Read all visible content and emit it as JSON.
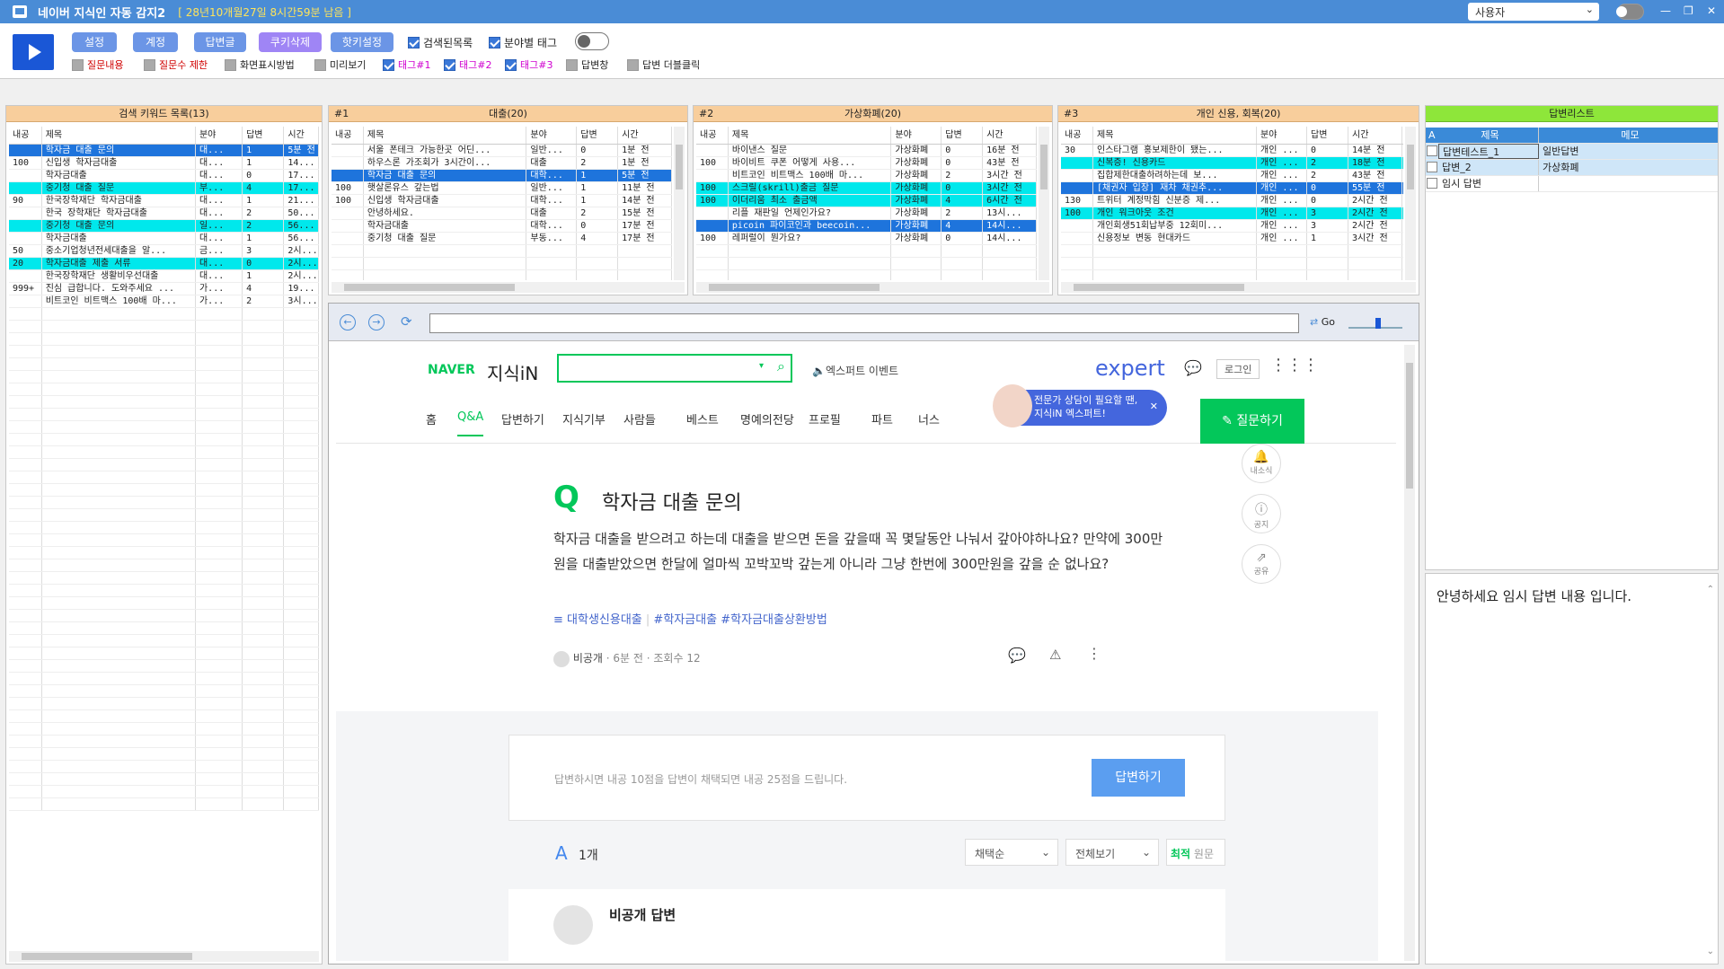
{
  "app": {
    "title": "네이버 지식인 자동 감지2",
    "license": "[ 28년10개월27일 8시간59분 남음 ]",
    "user_select": "사용자",
    "accent": "#4a8cd6"
  },
  "toolbar": {
    "buttons": [
      "설정",
      "계정",
      "답변글",
      "쿠키삭제",
      "핫키설정"
    ],
    "row1_checks": [
      {
        "label": "검색된목록",
        "checked": true
      },
      {
        "label": "분야별 태그",
        "checked": true
      }
    ],
    "row2_checks": [
      {
        "label": "질문내용",
        "checked": false,
        "color": "#d00000"
      },
      {
        "label": "질문수 제한",
        "checked": false,
        "color": "#d00000"
      },
      {
        "label": "화면표시방법",
        "checked": false,
        "color": "#222222"
      },
      {
        "label": "미리보기",
        "checked": false,
        "color": "#222222"
      },
      {
        "label": "태그#1",
        "checked": true,
        "color": "#d000d0"
      },
      {
        "label": "태그#2",
        "checked": true,
        "color": "#d000d0"
      },
      {
        "label": "태그#3",
        "checked": true,
        "color": "#d000d0"
      },
      {
        "label": "답변창",
        "checked": false,
        "color": "#222222"
      },
      {
        "label": "답변 더블클릭",
        "checked": false,
        "color": "#222222"
      }
    ]
  },
  "columns": [
    "내공",
    "제목",
    "분야",
    "답변",
    "시간"
  ],
  "keyword_panel": {
    "title": "검색 키워드 목록(13)",
    "rows": [
      {
        "n": "",
        "t": "학자금 대출 문의",
        "f": "대...",
        "a": "1",
        "time": "5분 전",
        "s": "blue"
      },
      {
        "n": "100",
        "t": "신입생 학자금대출",
        "f": "대...",
        "a": "1",
        "time": "14...",
        "s": ""
      },
      {
        "n": "",
        "t": "학자금대출",
        "f": "대...",
        "a": "0",
        "time": "17...",
        "s": ""
      },
      {
        "n": "",
        "t": "중기청 대출 질문",
        "f": "부...",
        "a": "4",
        "time": "17...",
        "s": "cyan"
      },
      {
        "n": "90",
        "t": "한국장학재단 학자금대출",
        "f": "대...",
        "a": "1",
        "time": "21...",
        "s": ""
      },
      {
        "n": "",
        "t": "한국 장학재단 학자금대출",
        "f": "대...",
        "a": "2",
        "time": "50...",
        "s": ""
      },
      {
        "n": "",
        "t": "중기청 대출 문의",
        "f": "일...",
        "a": "2",
        "time": "56...",
        "s": "cyan"
      },
      {
        "n": "",
        "t": "학자금대출",
        "f": "대...",
        "a": "1",
        "time": "56...",
        "s": ""
      },
      {
        "n": "50",
        "t": "중소기업청년전세대출을 알...",
        "f": "금...",
        "a": "3",
        "time": "2시...",
        "s": ""
      },
      {
        "n": "20",
        "t": "학자금대출 제출 서류",
        "f": "대...",
        "a": "0",
        "time": "2시...",
        "s": "cyan"
      },
      {
        "n": "",
        "t": "한국장학재단 생활비우선대출",
        "f": "대...",
        "a": "1",
        "time": "2시...",
        "s": ""
      },
      {
        "n": "999+",
        "t": "진심 급합니다. 도와주세요 ...",
        "f": "가...",
        "a": "4",
        "time": "19...",
        "s": ""
      },
      {
        "n": "",
        "t": "비트코인 비트맥스 100배 마...",
        "f": "가...",
        "a": "2",
        "time": "3시...",
        "s": ""
      }
    ]
  },
  "tag_panels": [
    {
      "num": "#1",
      "title": "대출(20)",
      "rows": [
        {
          "n": "",
          "t": "서울 폰테크 가능한곳 어딘...",
          "f": "일반...",
          "a": "0",
          "time": "1분 전",
          "s": ""
        },
        {
          "n": "",
          "t": "하우스론 가조회가 3시간이...",
          "f": "대출",
          "a": "2",
          "time": "1분 전",
          "s": ""
        },
        {
          "n": "",
          "t": "학자금 대출 문의",
          "f": "대학...",
          "a": "1",
          "time": "5분 전",
          "s": "blue"
        },
        {
          "n": "100",
          "t": "햇살론유스 갚는법",
          "f": "일반...",
          "a": "1",
          "time": "11분 전",
          "s": ""
        },
        {
          "n": "100",
          "t": "신입생 학자금대출",
          "f": "대학...",
          "a": "1",
          "time": "14분 전",
          "s": ""
        },
        {
          "n": "",
          "t": "안녕하세요.",
          "f": "대출",
          "a": "2",
          "time": "15분 전",
          "s": ""
        },
        {
          "n": "",
          "t": "학자금대출",
          "f": "대학...",
          "a": "0",
          "time": "17분 전",
          "s": ""
        },
        {
          "n": "",
          "t": "중기청 대출 질문",
          "f": "부동...",
          "a": "4",
          "time": "17분 전",
          "s": ""
        }
      ]
    },
    {
      "num": "#2",
      "title": "가상화폐(20)",
      "rows": [
        {
          "n": "",
          "t": "바이낸스 질문",
          "f": "가상화폐",
          "a": "0",
          "time": "16분 전",
          "s": ""
        },
        {
          "n": "100",
          "t": "바이비트 쿠폰 어떻게 사용...",
          "f": "가상화폐",
          "a": "0",
          "time": "43분 전",
          "s": ""
        },
        {
          "n": "",
          "t": "비트코인 비트맥스 100배 마...",
          "f": "가상화폐",
          "a": "2",
          "time": "3시간 전",
          "s": ""
        },
        {
          "n": "100",
          "t": "스크릴(skrill)출금 질문",
          "f": "가상화폐",
          "a": "0",
          "time": "3시간 전",
          "s": "cyan"
        },
        {
          "n": "100",
          "t": "이더리움 최소 출금액",
          "f": "가상화폐",
          "a": "4",
          "time": "6시간 전",
          "s": "cyan"
        },
        {
          "n": "",
          "t": "리플 재판일 언제인가요?",
          "f": "가상화폐",
          "a": "2",
          "time": "13시...",
          "s": ""
        },
        {
          "n": "",
          "t": "picoin 파이코인과 beecoin...",
          "f": "가상화폐",
          "a": "4",
          "time": "14시...",
          "s": "blue"
        },
        {
          "n": "100",
          "t": "레퍼럴이 뭔가요?",
          "f": "가상화폐",
          "a": "0",
          "time": "14시...",
          "s": ""
        }
      ]
    },
    {
      "num": "#3",
      "title": "개인 신용, 회복(20)",
      "rows": [
        {
          "n": "30",
          "t": "인스타그램 홍보제한이 됐는...",
          "f": "개인 ...",
          "a": "0",
          "time": "14분 전",
          "s": ""
        },
        {
          "n": "",
          "t": "신복증! 신용카드",
          "f": "개인 ...",
          "a": "2",
          "time": "18분 전",
          "s": "cyan"
        },
        {
          "n": "",
          "t": "집합제한대출하려하는데 보...",
          "f": "개인 ...",
          "a": "2",
          "time": "43분 전",
          "s": ""
        },
        {
          "n": "",
          "t": "[채권자 입장] 재차 채권추...",
          "f": "개인 ...",
          "a": "0",
          "time": "55분 전",
          "s": "blue"
        },
        {
          "n": "130",
          "t": "트위터 계정막힘 신분증 제...",
          "f": "개인 ...",
          "a": "0",
          "time": "2시간 전",
          "s": ""
        },
        {
          "n": "100",
          "t": "개인 워크아웃 조건",
          "f": "개인 ...",
          "a": "3",
          "time": "2시간 전",
          "s": "cyan"
        },
        {
          "n": "",
          "t": "개인회생51회납부중 12회미...",
          "f": "개인 ...",
          "a": "3",
          "time": "2시간 전",
          "s": ""
        },
        {
          "n": "",
          "t": "신용정보 변동 현대카드",
          "f": "개인 ...",
          "a": "1",
          "time": "3시간 전",
          "s": ""
        }
      ]
    }
  ],
  "answer_list": {
    "title": "답변리스트",
    "col_a": "A",
    "col_title": "제목",
    "col_memo": "메모",
    "rows": [
      {
        "title": "답변테스트_1",
        "memo": "일반답변"
      },
      {
        "title": "답변_2",
        "memo": "가상화폐"
      },
      {
        "title": "임시 답변",
        "memo": ""
      }
    ],
    "preview": "안녕하세요 임시 답변 내용 입니다."
  },
  "browser": {
    "go_label": "Go",
    "url": "",
    "logo_naver": "NAVER",
    "logo_kin": "지식iN",
    "expert_event": "엑스퍼트 이벤트",
    "expert_logo": "expert",
    "login": "로그인",
    "tooltip_line1": "전문가 상담이 필요할 땐,",
    "tooltip_line2": "지식iN 엑스퍼트!",
    "tabs": [
      "홈",
      "Q&A",
      "답변하기",
      "지식기부",
      "사람들",
      "베스트",
      "명예의전당",
      "프로필",
      "파트",
      "너스"
    ],
    "ask_button": "질문하기",
    "question": {
      "q_mark": "Q",
      "title": "학자금 대출 문의",
      "body": "학자금 대출을 받으려고 하는데 대출을 받으면 돈을 갚을때 꼭 몇달동안 나눠서 갚아야하나요? 만약에 300만원을 대출받았으면 한달에 얼마씩 꼬박꼬박 갚는게 아니라 그냥 한번에 300만원을 갚을 순 없나요?",
      "category": "대학생신용대출",
      "tags": [
        "#학자금대출",
        "#학자금대출상환방법"
      ],
      "author": "비공개",
      "time": "6분 전",
      "views": "조회수 12"
    },
    "side": [
      "내소식",
      "공지",
      "공유"
    ],
    "answer_prompt": "답변하시면 내공 10점을 답변이 채택되면 내공 25점을 드립니다.",
    "answer_button": "답변하기",
    "answers_count_label": "1개",
    "a_mark": "A",
    "sort_select": "채택순",
    "view_select": "전체보기",
    "filter_best": "최적",
    "filter_orig": "원문",
    "private_answer": "비공개 답변"
  }
}
